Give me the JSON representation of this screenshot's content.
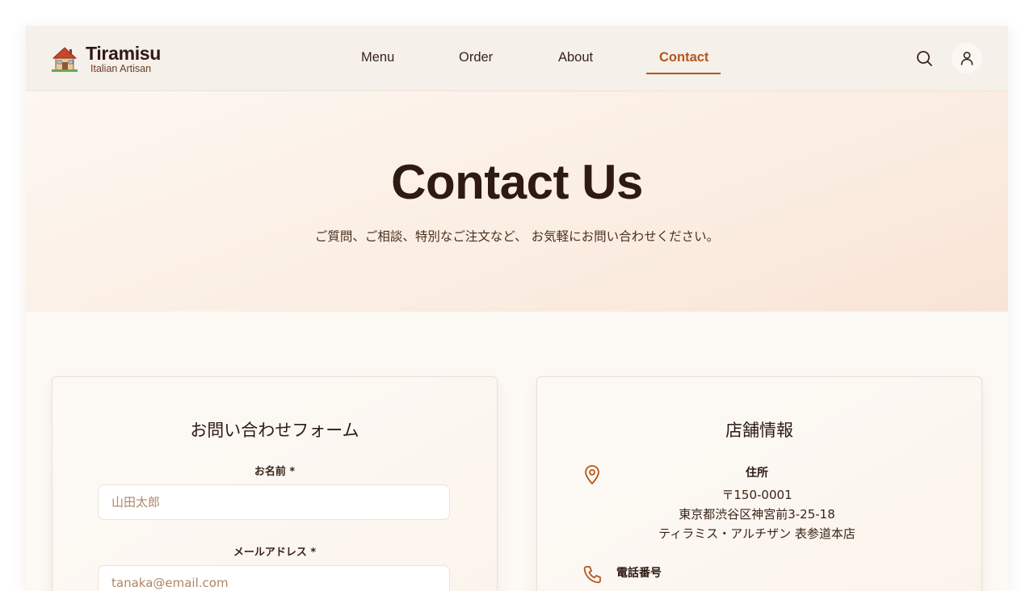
{
  "header": {
    "brand_name": "Tiramisu",
    "brand_tagline": "Italian Artisan",
    "nav": [
      "Menu",
      "Order",
      "About",
      "Contact"
    ],
    "active_nav": "Contact",
    "icons": {
      "logo": "house-icon",
      "search": "search-icon",
      "account": "user-icon"
    }
  },
  "hero": {
    "title": "Contact Us",
    "subtitle": "ご質問、ご相談、特別なご注文など、 お気軽にお問い合わせください。"
  },
  "form": {
    "title": "お問い合わせフォーム",
    "name_label": "お名前 *",
    "name_placeholder": "山田太郎",
    "email_label": "メールアドレス *",
    "email_placeholder": "tanaka@email.com"
  },
  "store": {
    "title": "店舗情報",
    "address_label": "住所",
    "address_lines": [
      "〒150-0001",
      "東京都渋谷区神宮前3-25-18",
      "ティラミス・アルチザン 表参道本店"
    ],
    "phone_label": "電話番号",
    "icons": {
      "address": "map-pin-icon",
      "phone": "phone-icon"
    }
  },
  "colors": {
    "accent": "#b5561e",
    "text_dark": "#2e1a12",
    "header_bg": "#f5f0ea",
    "hero_bg": "#fbeee3"
  }
}
